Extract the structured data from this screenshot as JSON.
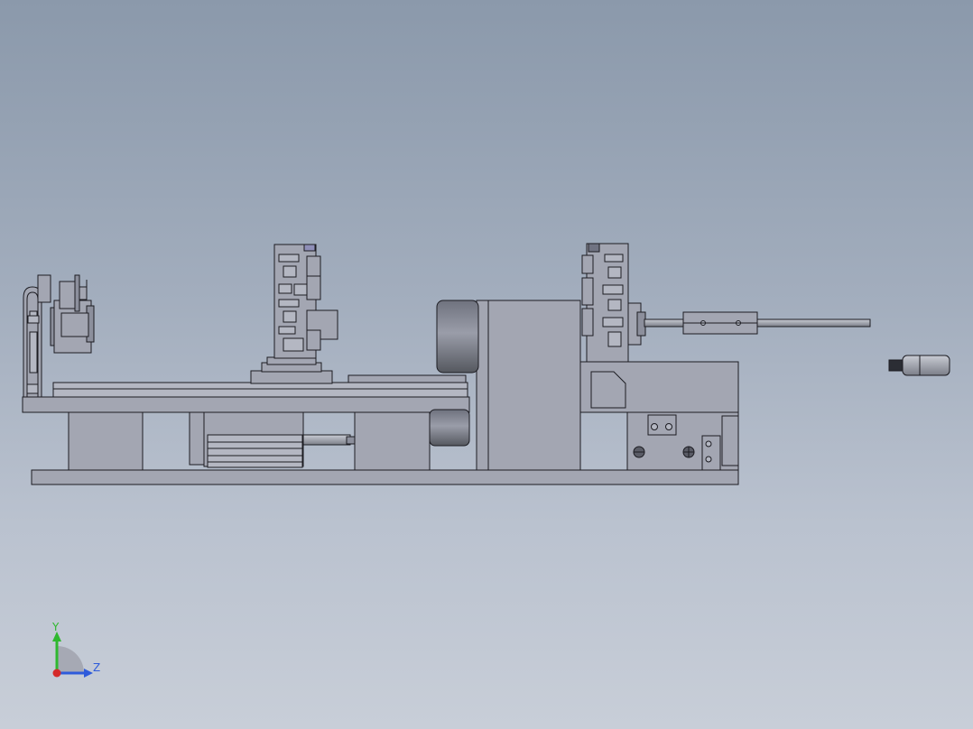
{
  "view": {
    "type": "cad-graphics-area",
    "background_gradient": [
      "#8b99ab",
      "#c8ced8"
    ],
    "model_colors": {
      "body": "#a3a6b2",
      "edge": "#1c1c22",
      "motor": "#7c7f8c"
    }
  },
  "triad": {
    "y_label": "Y",
    "z_label": "Z",
    "colors": {
      "y": "#2fb82f",
      "z": "#2e5bdb",
      "x": "#d42a2a"
    }
  }
}
